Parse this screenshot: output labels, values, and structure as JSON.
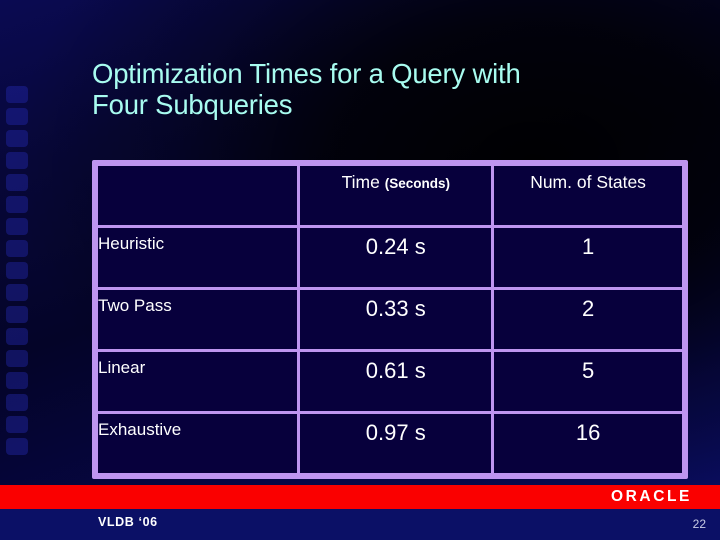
{
  "slide": {
    "title": "Optimization Times for a Query with\nFour Subqueries",
    "title_color": "#A8FCF0",
    "background_color": "#050530"
  },
  "table": {
    "border_color": "#BE95F0",
    "cell_background": "#07003C",
    "headers": {
      "label_column": "",
      "time_main": "Time",
      "time_unit": "(Seconds)",
      "num_states": "Num. of States"
    },
    "rows": [
      {
        "method": "Heuristic",
        "time": "0.24 s",
        "states": "1"
      },
      {
        "method": "Two Pass",
        "time": "0.33 s",
        "states": "2"
      },
      {
        "method": "Linear",
        "time": "0.61 s",
        "states": "5"
      },
      {
        "method": "Exhaustive",
        "time": "0.97 s",
        "states": "16"
      }
    ]
  },
  "chart_data": {
    "type": "table",
    "title": "Optimization Times for a Query with Four Subqueries",
    "categories": [
      "Heuristic",
      "Two Pass",
      "Linear",
      "Exhaustive"
    ],
    "series": [
      {
        "name": "Time (Seconds)",
        "values": [
          0.24,
          0.33,
          0.61,
          0.97
        ]
      },
      {
        "name": "Num. of States",
        "values": [
          1,
          2,
          5,
          16
        ]
      }
    ],
    "xlabel": "",
    "ylabel": "",
    "legend_position": "none",
    "grid": false
  },
  "footer": {
    "brand": "ORACLE",
    "brand_band_color": "#FA0000",
    "conference": "VLDB  ‘06",
    "page_number": "22"
  }
}
